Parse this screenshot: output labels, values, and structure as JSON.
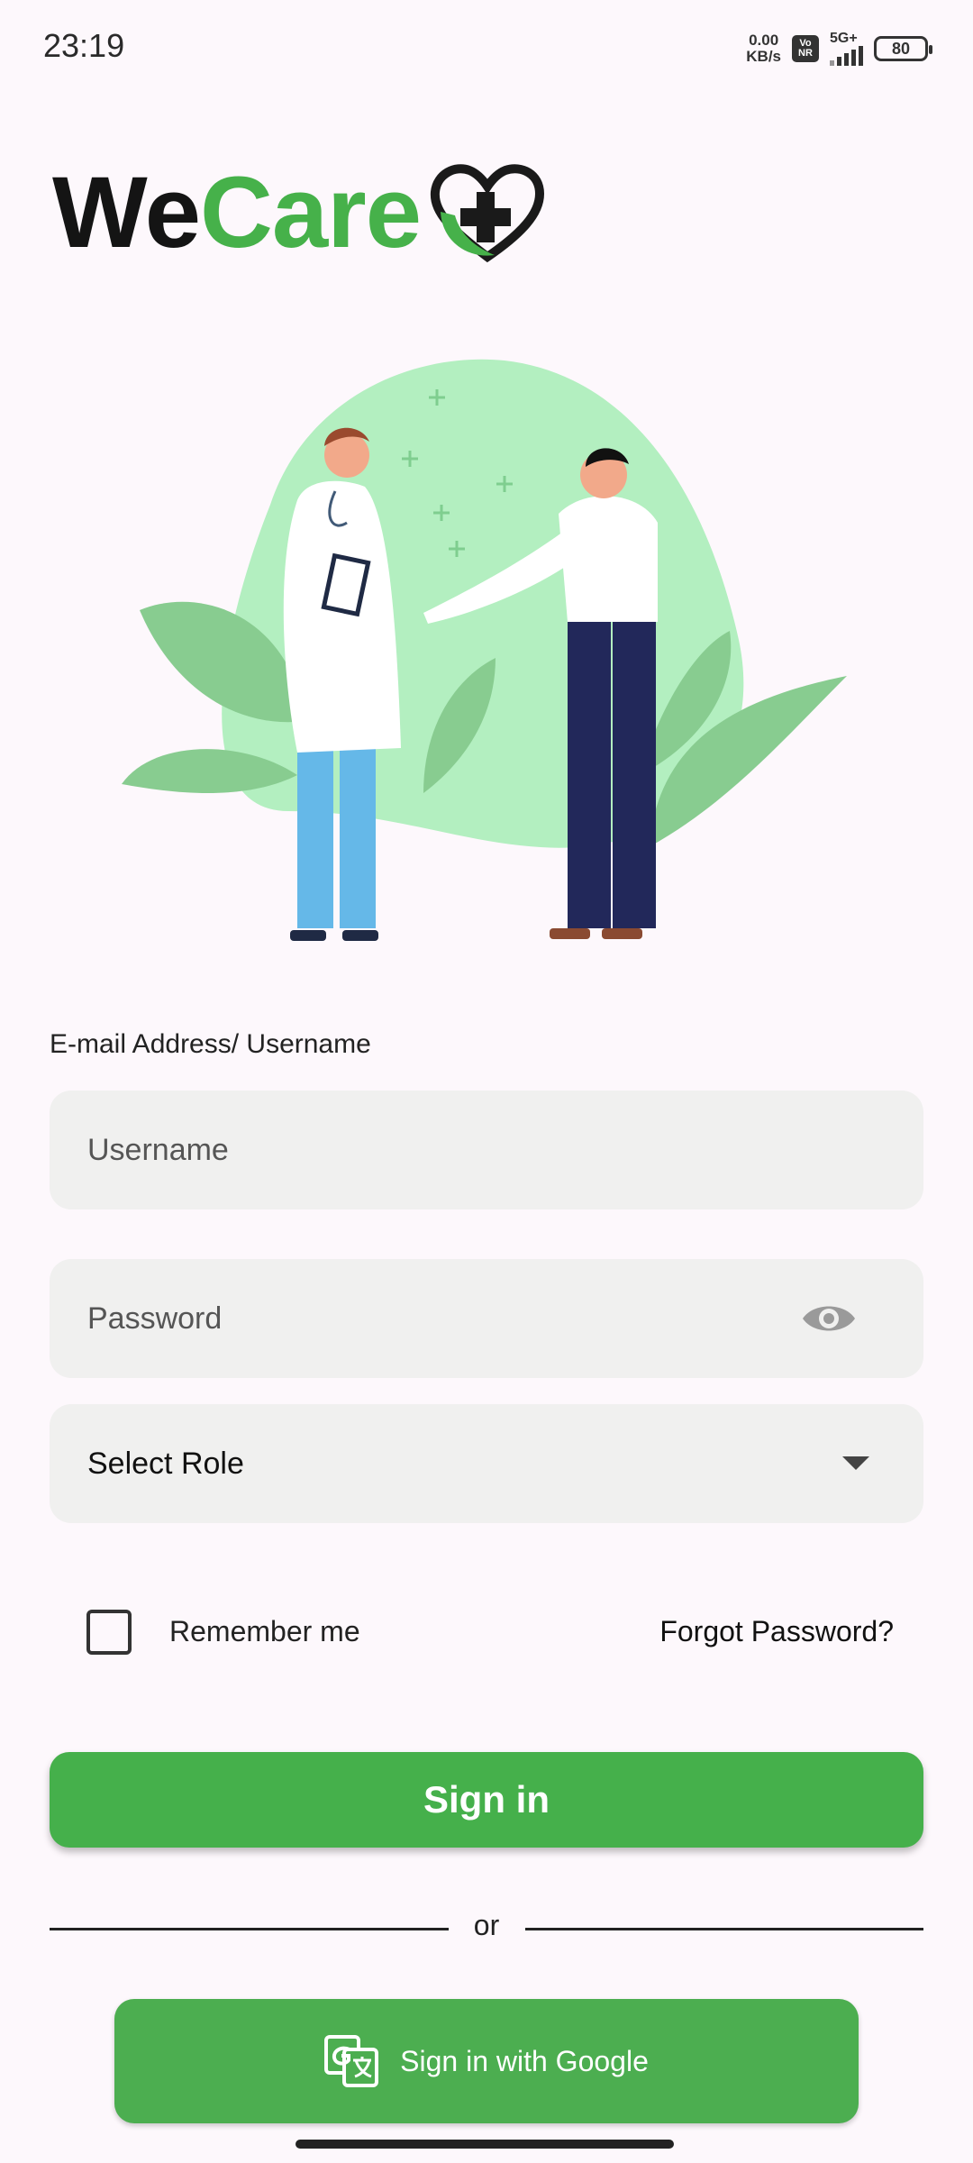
{
  "status_bar": {
    "time": "23:19",
    "net_speed_value": "0.00",
    "net_speed_unit": "KB/s",
    "vonr_top": "Vo",
    "vonr_bottom": "NR",
    "network": "5G+",
    "battery": "80"
  },
  "logo": {
    "part1": "We",
    "part2": "Care"
  },
  "form": {
    "email_label": "E-mail Address/ Username",
    "username_placeholder": "Username",
    "password_placeholder": "Password",
    "role_value": "Select Role",
    "remember_label": "Remember me",
    "forgot_label": "Forgot Password?",
    "signin_label": "Sign in",
    "or_label": "or",
    "google_label": "Sign in with Google"
  },
  "colors": {
    "brand_green": "#46b14a",
    "button_green": "#45b04b",
    "google_green": "#4cae50",
    "background": "#fdf8fc",
    "field_bg": "#f0f0ef"
  },
  "icons": {
    "password_toggle": "eye-icon",
    "role_dropdown": "chevron-down-icon",
    "google": "google-translate-icon"
  }
}
